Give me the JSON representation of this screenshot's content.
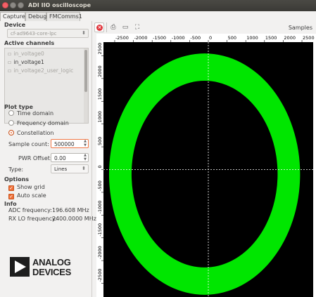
{
  "window": {
    "title": "ADI IIO oscilloscope"
  },
  "tabs": [
    {
      "label": "Capture",
      "active": true
    },
    {
      "label": "Debug",
      "active": false
    },
    {
      "label": "FMComms1",
      "active": false
    }
  ],
  "device": {
    "section": "Device",
    "selected": "cf-ad9643-core-lpc"
  },
  "channels": {
    "section": "Active channels",
    "items": [
      {
        "label": "in_voltage0",
        "enabled": false
      },
      {
        "label": "in_voltage1",
        "enabled": true
      },
      {
        "label": "in_voltage2_user_logic",
        "enabled": false
      }
    ]
  },
  "plot_type": {
    "section": "Plot type",
    "options": [
      {
        "label": "Time domain",
        "selected": false
      },
      {
        "label": "Frequency domain",
        "selected": false
      },
      {
        "label": "Constellation",
        "selected": true
      }
    ]
  },
  "params": {
    "sample_count_label": "Sample count:",
    "sample_count_value": "500000",
    "pwr_offset_label": "PWR Offset:",
    "pwr_offset_value": "0.00",
    "type_label": "Type:",
    "type_value": "Lines"
  },
  "options": {
    "section": "Options",
    "show_grid": "Show grid",
    "auto_scale": "Auto scale"
  },
  "info": {
    "section": "Info",
    "adc_label": "ADC frequency:",
    "adc_value": "196.608 MHz",
    "rxlo_label": "RX LO frequency:",
    "rxlo_value": "2400.0000 MHz"
  },
  "logo": {
    "line1": "ANALOG",
    "line2": "DEVICES"
  },
  "toolbar": {
    "samples_label": "Samples"
  },
  "chart_data": {
    "type": "scatter",
    "title": "",
    "xlabel": "",
    "ylabel": "",
    "xlim": [
      -2800,
      2800
    ],
    "ylim": [
      -2800,
      2800
    ],
    "grid": true,
    "x_ticks": [
      -2500,
      -2000,
      -1500,
      -1000,
      -500,
      0,
      500,
      1000,
      1500,
      2000,
      2500
    ],
    "y_ticks": [
      -2500,
      -2000,
      -1500,
      -1000,
      -500,
      0,
      500,
      1000,
      1500,
      2000,
      2500
    ],
    "ring": {
      "center": [
        -100,
        -100
      ],
      "outer_radius": [
        2550,
        2650
      ],
      "inner_radius": [
        1950,
        2050
      ],
      "color": "#00e600"
    },
    "background": "#000000",
    "grid_color": "#ffffff"
  }
}
